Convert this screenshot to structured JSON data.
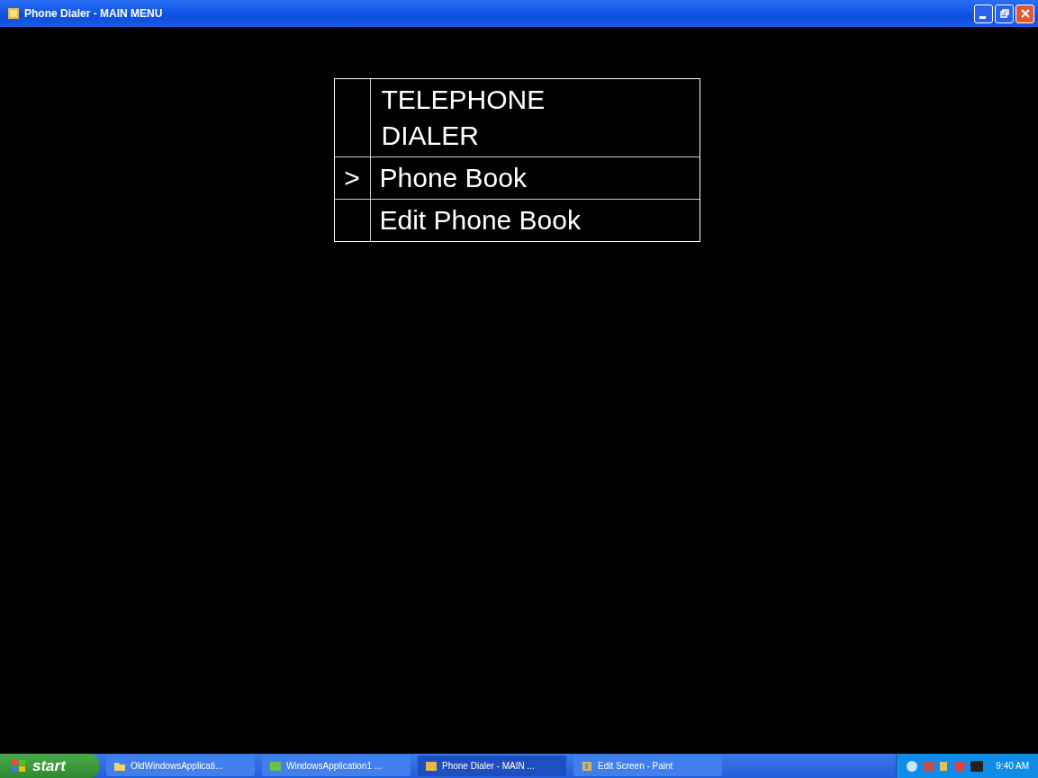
{
  "window": {
    "title": "Phone Dialer - MAIN MENU"
  },
  "menu": {
    "title": "TELEPHONE DIALER",
    "items": [
      {
        "marker": ">",
        "label": "Phone Book",
        "selected": true
      },
      {
        "label": "Edit Phone Book",
        "selected": false
      }
    ]
  },
  "taskbar": {
    "start": "start",
    "tasks": [
      {
        "label": "OldWindowsApplicati...",
        "kind": "folder",
        "selected": false
      },
      {
        "label": "WindowsApplication1 ...",
        "kind": "app",
        "selected": false
      },
      {
        "label": "Phone Dialer - MAIN ...",
        "kind": "app",
        "selected": true
      },
      {
        "label": "Edit Screen - Paint",
        "kind": "paint",
        "selected": false
      }
    ],
    "clock": "9:40 AM"
  }
}
